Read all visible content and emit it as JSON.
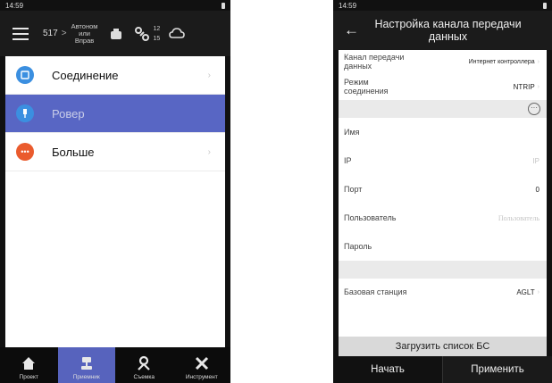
{
  "left": {
    "status": {
      "time": "14:59"
    },
    "header": {
      "satellites": "517",
      "separator": ">",
      "mode": "Автоном или Вправ",
      "count_top": "12",
      "count_bottom": "15"
    },
    "menu": [
      {
        "label": "Соединение",
        "icon": "connection-icon",
        "color": "#3b8fe0"
      },
      {
        "label": "Ровер",
        "icon": "rover-icon",
        "color": "#3b8fe0",
        "selected": true
      },
      {
        "label": "Больше",
        "icon": "more-icon",
        "color": "#ea5b2d"
      }
    ],
    "nav": [
      {
        "label": "Проект",
        "icon": "home-icon"
      },
      {
        "label": "Приемник",
        "icon": "receiver-icon",
        "active": true
      },
      {
        "label": "Съемка",
        "icon": "survey-icon"
      },
      {
        "label": "Инструмент",
        "icon": "tools-icon"
      }
    ]
  },
  "right": {
    "status": {
      "time": "14:59"
    },
    "title": "Настройка канала передачи данных",
    "rows": {
      "channel": {
        "label": "Канал передачи данных",
        "value": "Интернет контроллера"
      },
      "mode": {
        "label": "Режим соединения",
        "value": "NTRIP"
      },
      "name": {
        "label": "Имя"
      },
      "ip": {
        "label": "IP",
        "value": "IP"
      },
      "port": {
        "label": "Порт",
        "value": "0"
      },
      "user": {
        "label": "Пользователь",
        "value": "Пользователь"
      },
      "password": {
        "label": "Пароль"
      },
      "base": {
        "label": "Базовая станция",
        "value": "AGLT"
      }
    },
    "load_button": "Загрузить список БС",
    "start": "Начать",
    "apply": "Применить"
  },
  "colors": {
    "accent": "#5866c4",
    "nav_active": "#5763bd"
  }
}
